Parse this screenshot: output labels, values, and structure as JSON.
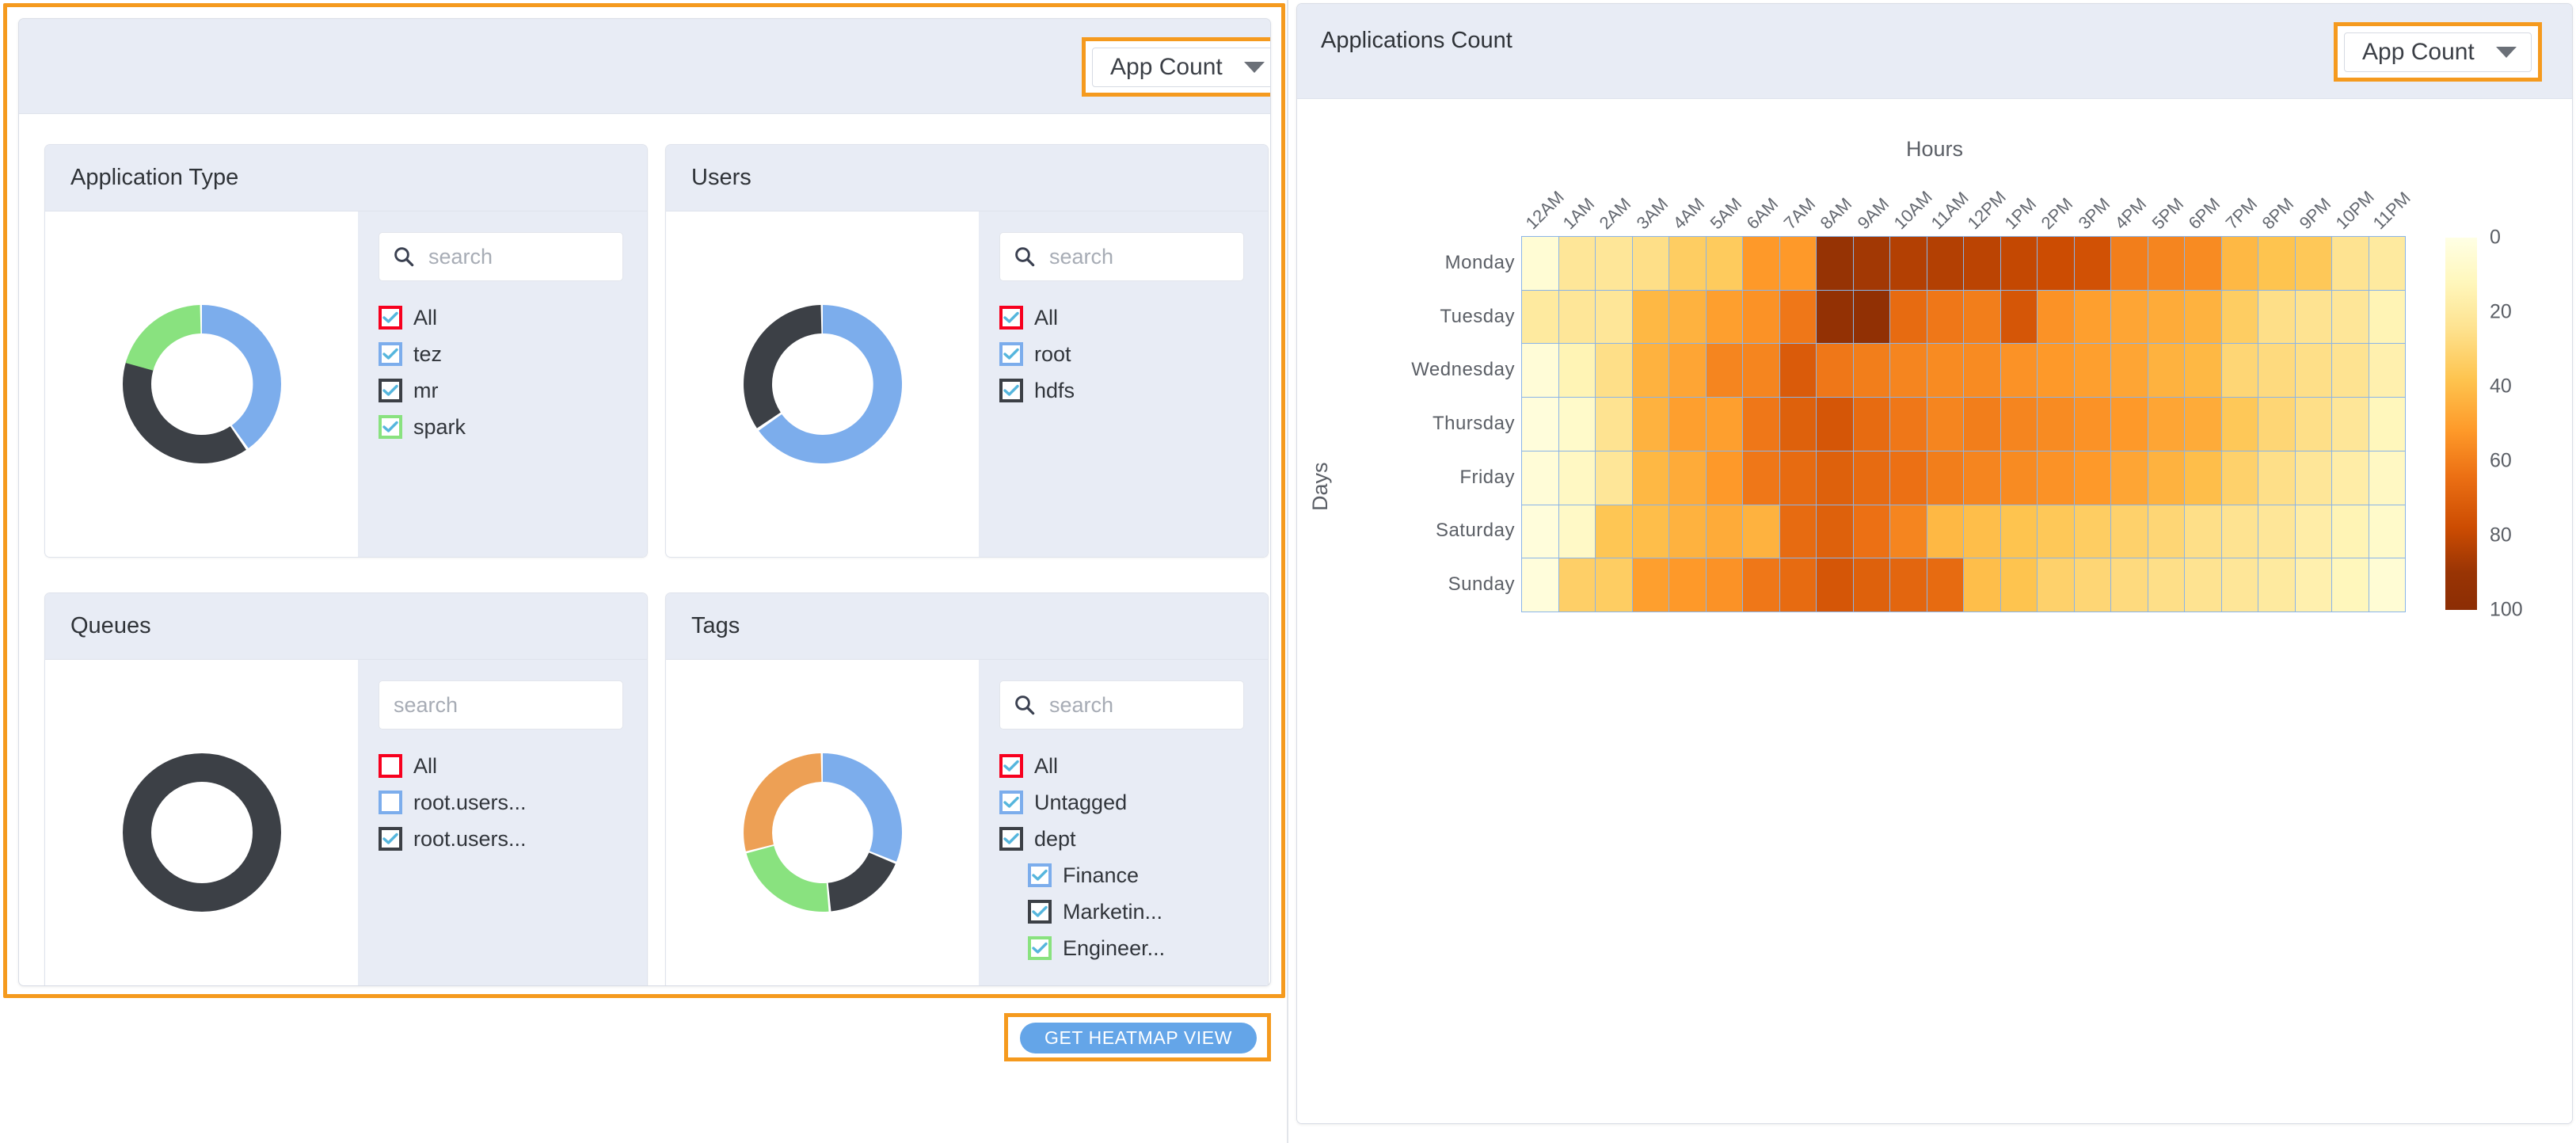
{
  "left_panel": {
    "metric_dropdown": {
      "value": "App Count",
      "caret_icon": "chevron-down-icon",
      "highlighted": true,
      "highlight_color": "#f59a1e"
    },
    "filters": [
      {
        "id": "application-type",
        "title": "Application Type",
        "search": {
          "placeholder": "search",
          "value": "",
          "has_icon": true
        },
        "donut": {
          "segments": [
            {
              "label": "tez",
              "color": "#7cadec",
              "percent": 40
            },
            {
              "label": "mr",
              "color": "#3c4046",
              "percent": 33
            },
            {
              "label": "spark",
              "color": "#89e27f",
              "percent": 27
            }
          ]
        },
        "items": [
          {
            "label": "All",
            "checked": true,
            "color": "#f7001e",
            "indent": false
          },
          {
            "label": "tez",
            "checked": true,
            "color": "#7cadec",
            "indent": false
          },
          {
            "label": "mr",
            "checked": true,
            "color": "#3c4046",
            "indent": false
          },
          {
            "label": "spark",
            "checked": true,
            "color": "#89e27f",
            "indent": false
          }
        ]
      },
      {
        "id": "users",
        "title": "Users",
        "search": {
          "placeholder": "search",
          "value": "",
          "has_icon": true
        },
        "donut": {
          "segments": [
            {
              "label": "root",
              "color": "#7cadec",
              "percent": 72
            },
            {
              "label": "hdfs",
              "color": "#3c4046",
              "percent": 28
            }
          ]
        },
        "items": [
          {
            "label": "All",
            "checked": true,
            "color": "#f7001e",
            "indent": false
          },
          {
            "label": "root",
            "checked": true,
            "color": "#7cadec",
            "indent": false
          },
          {
            "label": "hdfs",
            "checked": true,
            "color": "#3c4046",
            "indent": false
          }
        ]
      },
      {
        "id": "queues",
        "title": "Queues",
        "search": {
          "placeholder": "search",
          "value": "",
          "has_icon": false
        },
        "donut": {
          "segments": [
            {
              "label": "root.users...",
              "color": "#3c4046",
              "percent": 100
            }
          ]
        },
        "items": [
          {
            "label": "All",
            "checked": false,
            "color": "#f7001e",
            "indent": false
          },
          {
            "label": "root.users...",
            "checked": false,
            "color": "#7cadec",
            "indent": false
          },
          {
            "label": "root.users...",
            "checked": true,
            "color": "#3c4046",
            "indent": false
          }
        ]
      },
      {
        "id": "tags",
        "title": "Tags",
        "search": {
          "placeholder": "search",
          "value": "",
          "has_icon": true
        },
        "donut": {
          "segments": [
            {
              "label": "Untagged",
              "color": "#7cadec",
              "percent": 18
            },
            {
              "label": "Marketin…",
              "color": "#3c4046",
              "percent": 27
            },
            {
              "label": "Engineer…",
              "color": "#89e27f",
              "percent": 28
            },
            {
              "label": "Finance",
              "color": "#eda055",
              "percent": 27
            }
          ]
        },
        "items": [
          {
            "label": "All",
            "checked": true,
            "color": "#f7001e",
            "indent": false
          },
          {
            "label": "Untagged",
            "checked": true,
            "color": "#7cadec",
            "indent": false
          },
          {
            "label": "dept",
            "checked": true,
            "color": "#3c4046",
            "indent": false
          },
          {
            "label": "Finance",
            "checked": true,
            "color": "#7cadec",
            "indent": true
          },
          {
            "label": "Marketin...",
            "checked": true,
            "color": "#3c4046",
            "indent": true
          },
          {
            "label": "Engineer...",
            "checked": true,
            "color": "#89e27f",
            "indent": true
          }
        ]
      }
    ],
    "get_heatmap_button": {
      "label": "GET HEATMAP VIEW",
      "color": "#64a5e8",
      "highlighted": true,
      "highlight_color": "#f59a1e"
    }
  },
  "right_panel": {
    "title": "Applications Count",
    "metric_dropdown": {
      "value": "App Count",
      "caret_icon": "chevron-down-icon",
      "highlighted": true,
      "highlight_color": "#f59a1e"
    }
  },
  "chart_data": {
    "type": "heatmap",
    "title": "Applications Count",
    "xlabel": "Hours",
    "ylabel": "Days",
    "grid": true,
    "legend_position": "right",
    "colorscale": {
      "name": "YlOrRd",
      "min": 0,
      "max": 100,
      "ticks": [
        0,
        20,
        40,
        60,
        80,
        100
      ],
      "stops": [
        "#ffffe5",
        "#fff7bc",
        "#fee391",
        "#fec44f",
        "#fe9929",
        "#ec7014",
        "#cc4c02",
        "#993404",
        "#8c2d04"
      ]
    },
    "x": [
      "12AM",
      "1AM",
      "2AM",
      "3AM",
      "4AM",
      "5AM",
      "6AM",
      "7AM",
      "8AM",
      "9AM",
      "10AM",
      "11AM",
      "12PM",
      "1PM",
      "2PM",
      "3PM",
      "4PM",
      "5PM",
      "6PM",
      "7PM",
      "8PM",
      "9PM",
      "10PM",
      "11PM"
    ],
    "y": [
      "Monday",
      "Tuesday",
      "Wednesday",
      "Thursday",
      "Friday",
      "Saturday",
      "Sunday"
    ],
    "z": [
      [
        5,
        22,
        22,
        26,
        34,
        35,
        52,
        52,
        92,
        88,
        84,
        84,
        82,
        80,
        78,
        76,
        60,
        58,
        56,
        42,
        38,
        36,
        24,
        20
      ],
      [
        20,
        22,
        22,
        42,
        44,
        50,
        54,
        62,
        95,
        96,
        66,
        62,
        60,
        74,
        54,
        50,
        48,
        46,
        44,
        34,
        26,
        24,
        22,
        14
      ],
      [
        4,
        14,
        26,
        44,
        48,
        58,
        58,
        72,
        62,
        60,
        58,
        56,
        56,
        54,
        52,
        50,
        48,
        44,
        42,
        30,
        28,
        26,
        24,
        16
      ],
      [
        3,
        8,
        24,
        44,
        50,
        50,
        62,
        70,
        74,
        66,
        62,
        58,
        60,
        58,
        56,
        54,
        52,
        48,
        46,
        36,
        30,
        26,
        22,
        12
      ],
      [
        4,
        10,
        22,
        42,
        46,
        52,
        62,
        66,
        70,
        66,
        64,
        60,
        58,
        56,
        54,
        52,
        48,
        44,
        40,
        32,
        26,
        22,
        18,
        10
      ],
      [
        3,
        9,
        37,
        40,
        44,
        46,
        44,
        66,
        70,
        64,
        58,
        42,
        40,
        38,
        36,
        34,
        32,
        30,
        26,
        24,
        22,
        18,
        14,
        8
      ],
      [
        3,
        33,
        34,
        50,
        52,
        54,
        62,
        66,
        74,
        70,
        68,
        66,
        40,
        38,
        32,
        30,
        28,
        26,
        24,
        22,
        20,
        16,
        12,
        5
      ]
    ]
  }
}
